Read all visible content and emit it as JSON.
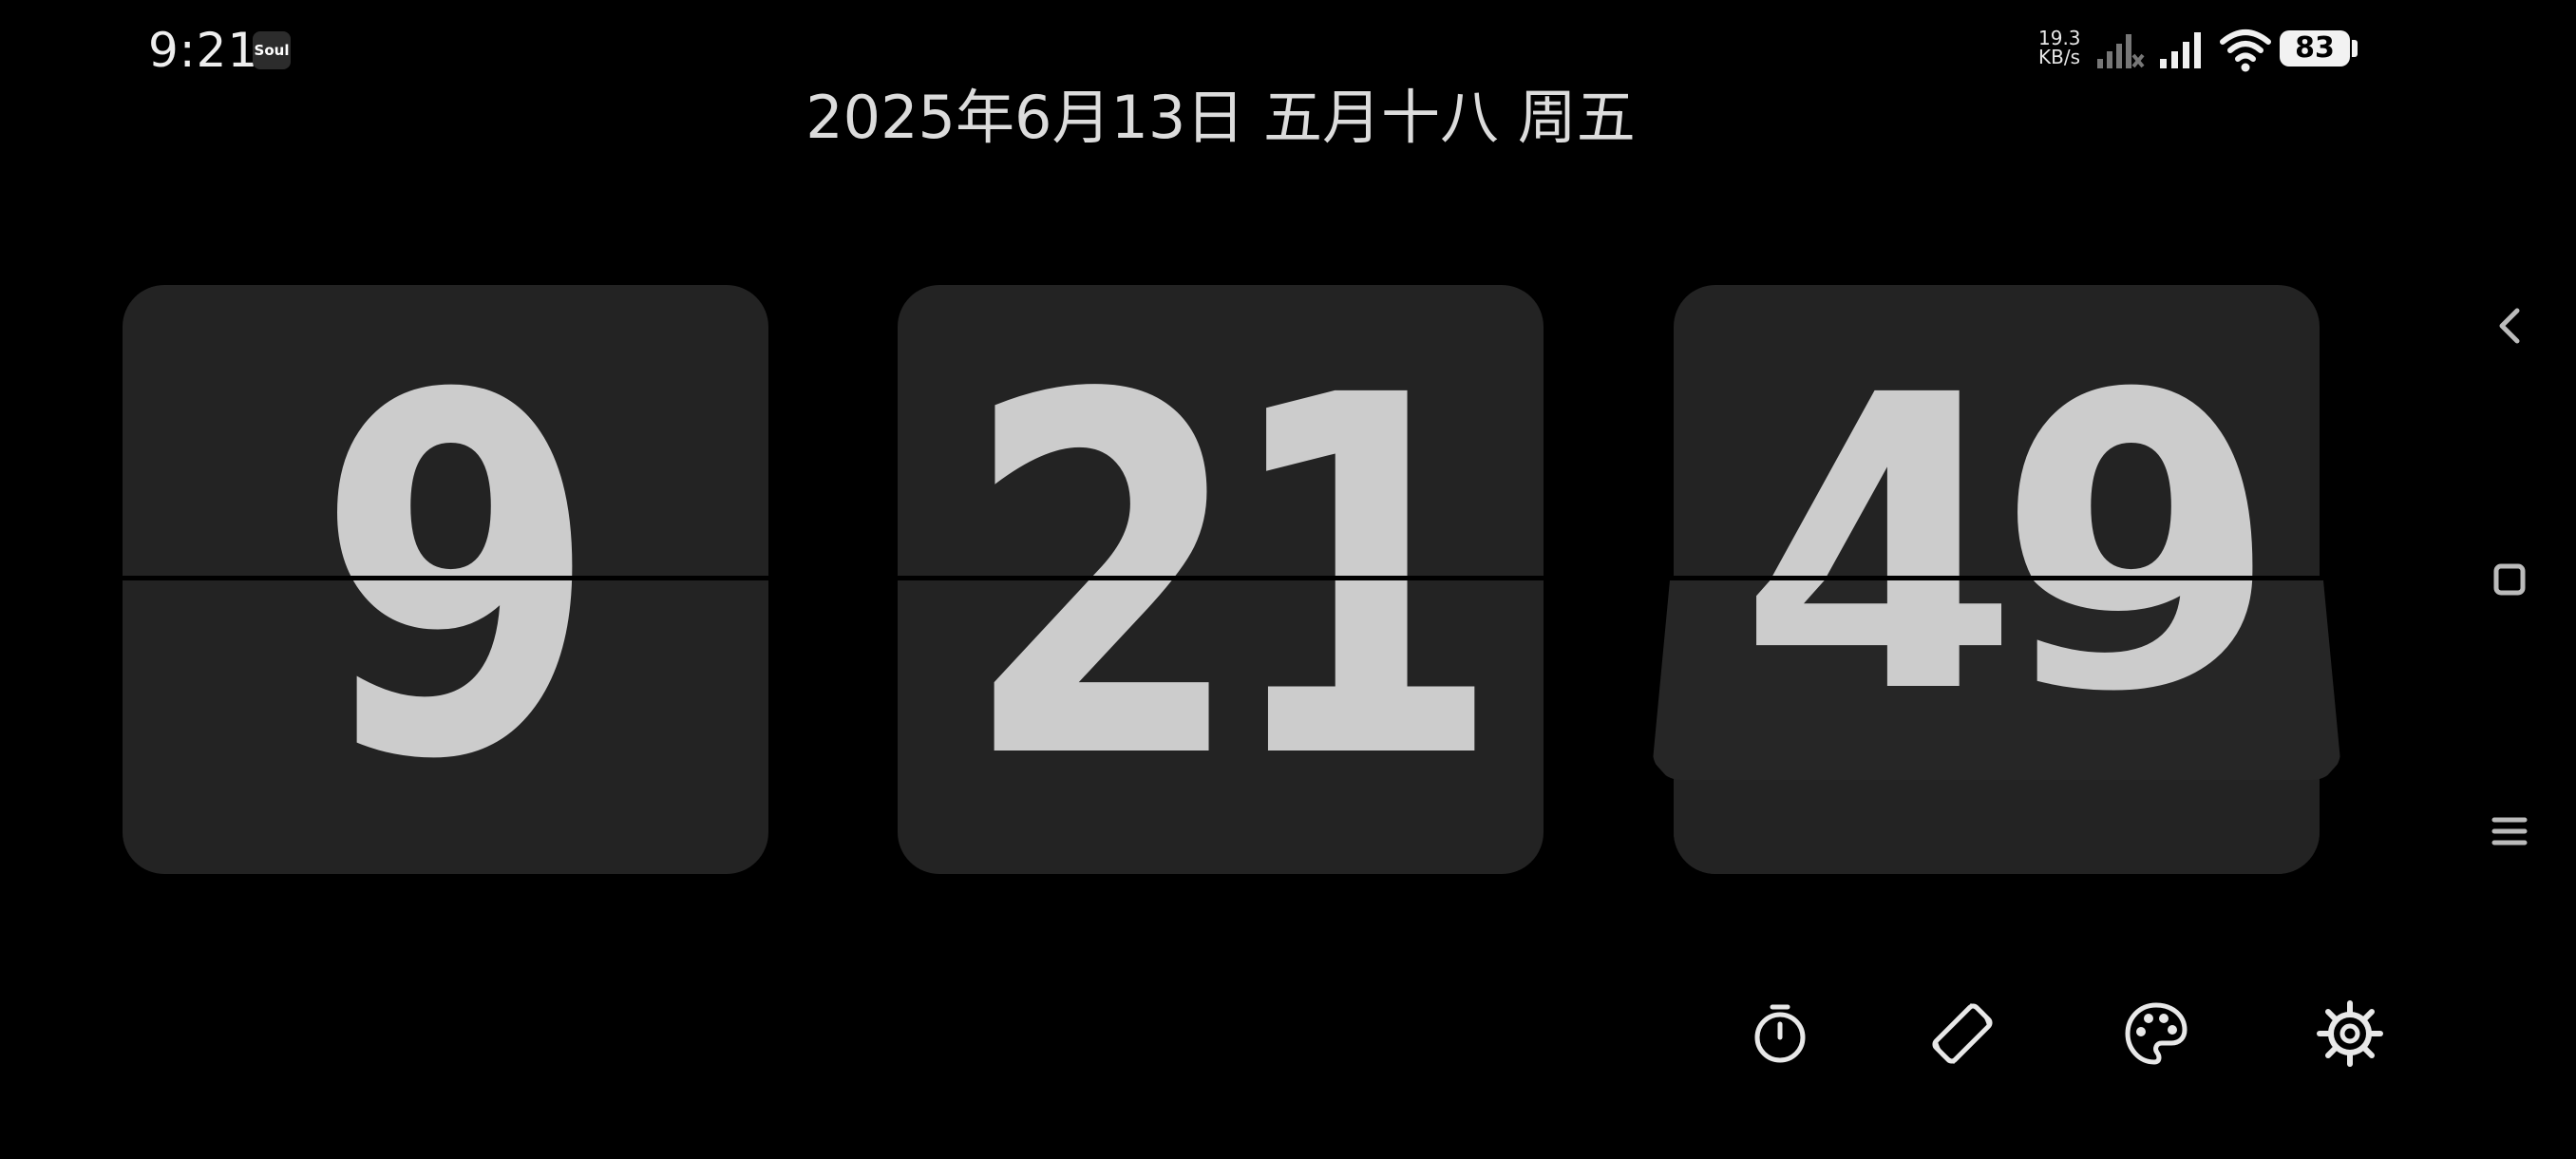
{
  "status_bar": {
    "time": "9:21",
    "app_icon_label": "Soul",
    "net_speed_value": "19.3",
    "net_speed_unit": "KB/s",
    "battery": "83",
    "icons": [
      "signal-sim1-icon",
      "signal-sim2-icon",
      "wifi-icon",
      "battery-icon"
    ]
  },
  "date": {
    "text": "2025年6月13日 五月十八 周五"
  },
  "clock": {
    "hours": "9",
    "minutes": "21",
    "seconds": "49"
  },
  "toolbar": {
    "icons": [
      "timer-icon",
      "screen-rotate-icon",
      "palette-icon",
      "gear-icon"
    ]
  },
  "navigation": {
    "icons": [
      "back-icon",
      "home-icon",
      "recents-icon"
    ]
  },
  "colors": {
    "background": "#000000",
    "card": "#232323",
    "digit": "#cccccc",
    "text": "#dcdcdc"
  }
}
